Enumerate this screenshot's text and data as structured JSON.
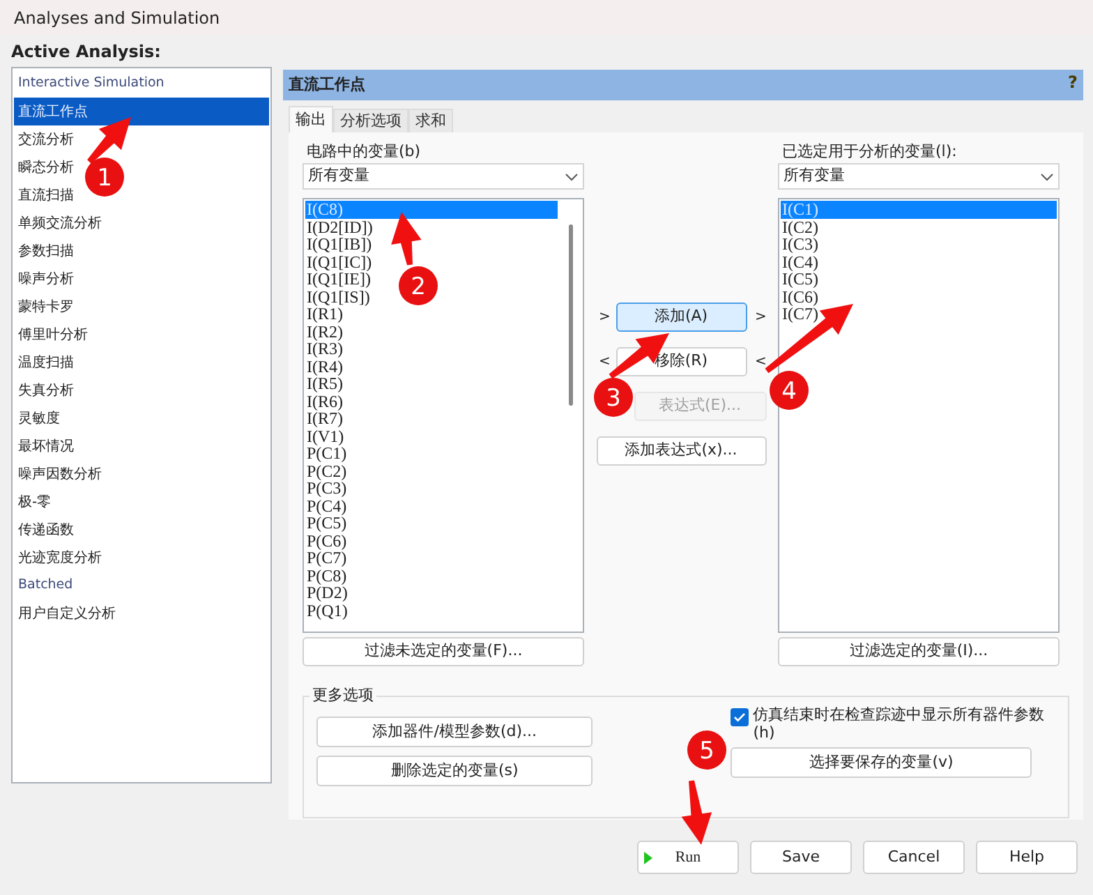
{
  "window": {
    "title": "Analyses and Simulation"
  },
  "active_analysis": {
    "label": "Active Analysis:",
    "items": [
      {
        "label": "Interactive Simulation",
        "kind": "special",
        "selected": false
      },
      {
        "label": "直流工作点",
        "kind": "analysis",
        "selected": true
      },
      {
        "label": "交流分析",
        "kind": "analysis",
        "selected": false
      },
      {
        "label": "瞬态分析",
        "kind": "analysis",
        "selected": false
      },
      {
        "label": "直流扫描",
        "kind": "analysis",
        "selected": false
      },
      {
        "label": "单频交流分析",
        "kind": "analysis",
        "selected": false
      },
      {
        "label": "参数扫描",
        "kind": "analysis",
        "selected": false
      },
      {
        "label": "噪声分析",
        "kind": "analysis",
        "selected": false
      },
      {
        "label": "蒙特卡罗",
        "kind": "analysis",
        "selected": false
      },
      {
        "label": "傅里叶分析",
        "kind": "analysis",
        "selected": false
      },
      {
        "label": "温度扫描",
        "kind": "analysis",
        "selected": false
      },
      {
        "label": "失真分析",
        "kind": "analysis",
        "selected": false
      },
      {
        "label": "灵敏度",
        "kind": "analysis",
        "selected": false
      },
      {
        "label": "最坏情况",
        "kind": "analysis",
        "selected": false
      },
      {
        "label": "噪声因数分析",
        "kind": "analysis",
        "selected": false
      },
      {
        "label": "极-零",
        "kind": "analysis",
        "selected": false
      },
      {
        "label": "传递函数",
        "kind": "analysis",
        "selected": false
      },
      {
        "label": "光迹宽度分析",
        "kind": "analysis",
        "selected": false
      },
      {
        "label": "Batched",
        "kind": "special",
        "selected": false
      },
      {
        "label": "用户自定义分析",
        "kind": "analysis",
        "selected": false
      }
    ]
  },
  "panel": {
    "title": "直流工作点",
    "help": "?",
    "tabs": [
      {
        "label": "输出",
        "selected": true
      },
      {
        "label": "分析选项",
        "selected": false
      },
      {
        "label": "求和",
        "selected": false
      }
    ],
    "circuit_variables": {
      "label": "电路中的变量(b)",
      "filter": "所有变量",
      "filter_button": "过滤未选定的变量(F)...",
      "items": [
        {
          "text": "I(C8)",
          "selected": true
        },
        {
          "text": "I(D2[ID])",
          "selected": false
        },
        {
          "text": "I(Q1[IB])",
          "selected": false
        },
        {
          "text": "I(Q1[IC])",
          "selected": false
        },
        {
          "text": "I(Q1[IE])",
          "selected": false
        },
        {
          "text": "I(Q1[IS])",
          "selected": false
        },
        {
          "text": "I(R1)",
          "selected": false
        },
        {
          "text": "I(R2)",
          "selected": false
        },
        {
          "text": "I(R3)",
          "selected": false
        },
        {
          "text": "I(R4)",
          "selected": false
        },
        {
          "text": "I(R5)",
          "selected": false
        },
        {
          "text": "I(R6)",
          "selected": false
        },
        {
          "text": "I(R7)",
          "selected": false
        },
        {
          "text": "I(V1)",
          "selected": false
        },
        {
          "text": "P(C1)",
          "selected": false
        },
        {
          "text": "P(C2)",
          "selected": false
        },
        {
          "text": "P(C3)",
          "selected": false
        },
        {
          "text": "P(C4)",
          "selected": false
        },
        {
          "text": "P(C5)",
          "selected": false
        },
        {
          "text": "P(C6)",
          "selected": false
        },
        {
          "text": "P(C7)",
          "selected": false
        },
        {
          "text": "P(C8)",
          "selected": false
        },
        {
          "text": "P(D2)",
          "selected": false
        },
        {
          "text": "P(Q1)",
          "selected": false
        }
      ]
    },
    "transfer_buttons": [
      {
        "label": "添加(A)",
        "marker": ">",
        "focused": true
      },
      {
        "label": "移除(R)",
        "marker": "<",
        "focused": false
      }
    ],
    "expression_buttons": [
      {
        "label": "表达式(E)...",
        "disabled": true
      },
      {
        "label": "添加表达式(x)...",
        "disabled": false
      }
    ],
    "selected_variables": {
      "label": "已选定用于分析的变量(l):",
      "filter": "所有变量",
      "filter_button": "过滤选定的变量(I)...",
      "items": [
        {
          "text": "I(C1)",
          "selected": true
        },
        {
          "text": "I(C2)",
          "selected": false
        },
        {
          "text": "I(C3)",
          "selected": false
        },
        {
          "text": "I(C4)",
          "selected": false
        },
        {
          "text": "I(C5)",
          "selected": false
        },
        {
          "text": "I(C6)",
          "selected": false
        },
        {
          "text": "I(C7)",
          "selected": false
        }
      ]
    },
    "more_options": {
      "title": "更多选项",
      "buttons": [
        "添加器件/模型参数(d)...",
        "删除选定的变量(s)"
      ],
      "checkbox": {
        "label": "仿真结束时在检查踪迹中显示所有器件参数(h)",
        "checked": true
      },
      "save_button": "选择要保存的变量(v)"
    }
  },
  "footer_buttons": [
    {
      "label": "Run",
      "kind": "run"
    },
    {
      "label": "Save",
      "kind": "plain"
    },
    {
      "label": "Cancel",
      "kind": "plain"
    },
    {
      "label": "Help",
      "kind": "plain"
    }
  ],
  "annotations": [
    {
      "number": "1"
    },
    {
      "number": "2"
    },
    {
      "number": "3"
    },
    {
      "number": "4"
    },
    {
      "number": "5"
    }
  ]
}
